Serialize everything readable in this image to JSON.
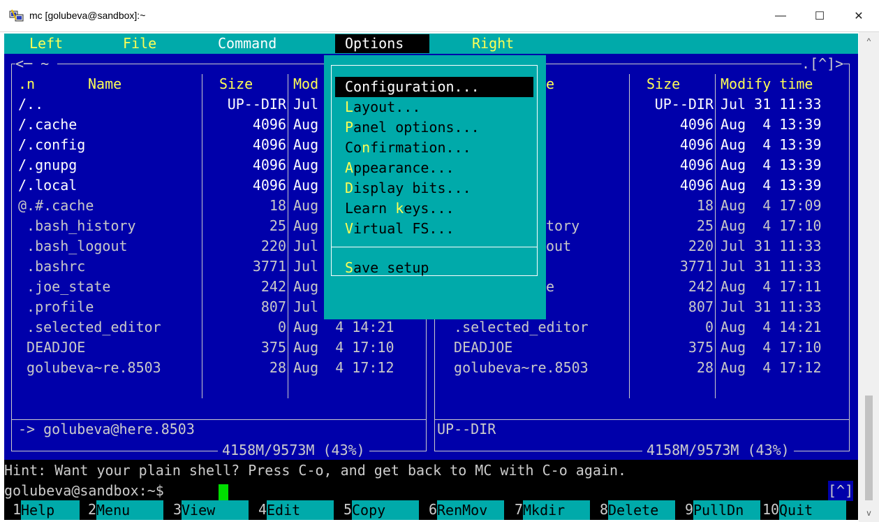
{
  "window": {
    "title": "mc [golubeva@sandbox]:~",
    "min": "—",
    "max": "☐",
    "close": "✕"
  },
  "menubar": {
    "left": "Left",
    "file": "File",
    "command": "Command",
    "options": "Options",
    "right": "Right"
  },
  "panels": {
    "left_top": "<─ ~ ",
    "right_top": ".[^]>",
    "col_name_n": ".n",
    "col_name": "Name",
    "col_size": "Size",
    "col_modify": "Mod",
    "right_col_name": "e",
    "right_col_size": "Size",
    "right_col_modify": "Modify time",
    "rows": [
      {
        "name": "/..",
        "size": "UP--DIR",
        "date": "Jul 31 11:33",
        "style": "white"
      },
      {
        "name": "/.cache",
        "size": "4096",
        "date": "Aug  4 13:39",
        "style": "white"
      },
      {
        "name": "/.config",
        "size": "4096",
        "date": "Aug  4 13:39",
        "style": "white"
      },
      {
        "name": "/.gnupg",
        "size": "4096",
        "date": "Aug  4 13:39",
        "style": "white"
      },
      {
        "name": "/.local",
        "size": "4096",
        "date": "Aug  4 13:39",
        "style": "white"
      },
      {
        "name": "@.#.cache",
        "size": "18",
        "date": "Aug  4 17:09",
        "style": "dim"
      },
      {
        "name": " .bash_history",
        "size": "25",
        "date": "Aug  4 17:10",
        "style": "dim"
      },
      {
        "name": " .bash_logout",
        "size": "220",
        "date": "Jul 31 11:33",
        "style": "dim"
      },
      {
        "name": " .bashrc",
        "size": "3771",
        "date": "Jul 31 11:33",
        "style": "dim"
      },
      {
        "name": " .joe_state",
        "size": "242",
        "date": "Aug  4 17:11",
        "style": "dim"
      },
      {
        "name": " .profile",
        "size": "807",
        "date": "Jul 31 11:33",
        "style": "dim"
      },
      {
        "name": " .selected_editor",
        "size": "0",
        "date": "Aug  4 14:21",
        "style": "dim"
      },
      {
        "name": " DEADJOE",
        "size": "375",
        "date": "Aug  4 17:10",
        "style": "dim"
      },
      {
        "name": " golubeva~re.8503",
        "size": "28",
        "date": "Aug  4 17:12",
        "style": "dim"
      }
    ],
    "right_partial": {
      "bash_history": "tory",
      "bash_logout": "out",
      "joe_state": "e"
    },
    "left_status": "-> golubeva@here.8503",
    "right_status": "UP--DIR",
    "left_disk": "4158M/9573M (43%)",
    "right_disk": "4158M/9573M (43%)"
  },
  "options_menu": {
    "items": [
      {
        "pre": "",
        "hk": "C",
        "post": "onfiguration...",
        "selected": true
      },
      {
        "pre": "",
        "hk": "L",
        "post": "ayout..."
      },
      {
        "pre": "",
        "hk": "P",
        "post": "anel options..."
      },
      {
        "pre": "Co",
        "hk": "n",
        "post": "firmation..."
      },
      {
        "pre": "",
        "hk": "A",
        "post": "ppearance..."
      },
      {
        "pre": "",
        "hk": "D",
        "post": "isplay bits..."
      },
      {
        "pre": "Learn ",
        "hk": "k",
        "post": "eys..."
      },
      {
        "pre": "",
        "hk": "V",
        "post": "irtual FS..."
      }
    ],
    "save_setup_hk": "S",
    "save_setup_rest": "ave setup"
  },
  "hint": "Hint: Want your plain shell? Press C-o, and get back to MC with C-o again.",
  "prompt": "golubeva@sandbox:~$ ",
  "corner": "[^]",
  "fkeys": [
    {
      "n": " 1",
      "label": "Help"
    },
    {
      "n": "2",
      "label": "Menu"
    },
    {
      "n": "3",
      "label": "View"
    },
    {
      "n": "4",
      "label": "Edit"
    },
    {
      "n": "5",
      "label": "Copy"
    },
    {
      "n": "6",
      "label": "RenMov"
    },
    {
      "n": "7",
      "label": "Mkdir"
    },
    {
      "n": "8",
      "label": "Delete"
    },
    {
      "n": "9",
      "label": "PullDn"
    },
    {
      "n": "10",
      "label": "Quit"
    }
  ],
  "colors": {
    "terminal_bg": "#0000aa",
    "cyan": "#00aaaa",
    "cursor": "#00dd00",
    "hotkey": "#ffff55"
  }
}
